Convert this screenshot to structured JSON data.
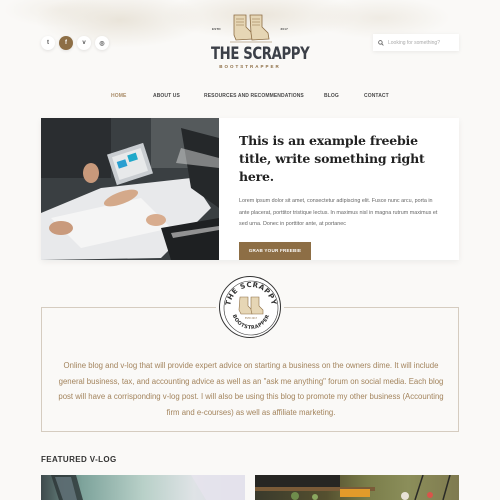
{
  "header": {
    "social": [
      {
        "name": "twitter",
        "glyph": "t"
      },
      {
        "name": "facebook",
        "glyph": "f"
      },
      {
        "name": "vimeo",
        "glyph": "v"
      },
      {
        "name": "instagram",
        "glyph": "◎"
      }
    ],
    "logo": {
      "estd": "ESTD",
      "year": "2017",
      "title": "THE SCRAPPY",
      "subtitle": "BOOTSTRAPPER"
    },
    "search": {
      "placeholder": "Looking for something?",
      "value": ""
    }
  },
  "nav": {
    "items": [
      {
        "label": "HOME",
        "active": true
      },
      {
        "label": "ABOUT US",
        "active": false
      },
      {
        "label": "RESOURCES AND RECOMMENDATIONS",
        "active": false
      },
      {
        "label": "BLOG",
        "active": false
      },
      {
        "label": "CONTACT",
        "active": false
      }
    ]
  },
  "feature": {
    "title": "This is an example freebie title, write something right here.",
    "body": "Lorem ipsum dolor sit amet, consectetur adipiscing elit. Fusce nunc arcu, porta in ante placerat, porttitor tristique lectus. In maximus nisl in magna rutrum maximus et sed urna. Donec in porttitor ante, at portanec",
    "cta_label": "GRAB YOUR FREEBIE"
  },
  "about": {
    "badge": {
      "top_text": "THE SCRAPPY",
      "bottom_text": "BOOTSTRAPPER",
      "estd": "ESTD 2017"
    },
    "text": "Online blog and v-log that will provide expert advice on starting a business on the owners dime. It will include general business, tax, and accounting advice as well as an \"ask me anything\" forum on social media. Each blog post will have a corrisponding v-log post. I will also be using this blog to promote my other business (Accounting firm and e-courses) as well as affiliate marketing."
  },
  "featured_vlog": {
    "title": "FEATURED V-LOG"
  },
  "colors": {
    "accent": "#8d6e45",
    "nav_active": "#a88b66",
    "about_text": "#a3845d",
    "background": "#faf9f7"
  }
}
